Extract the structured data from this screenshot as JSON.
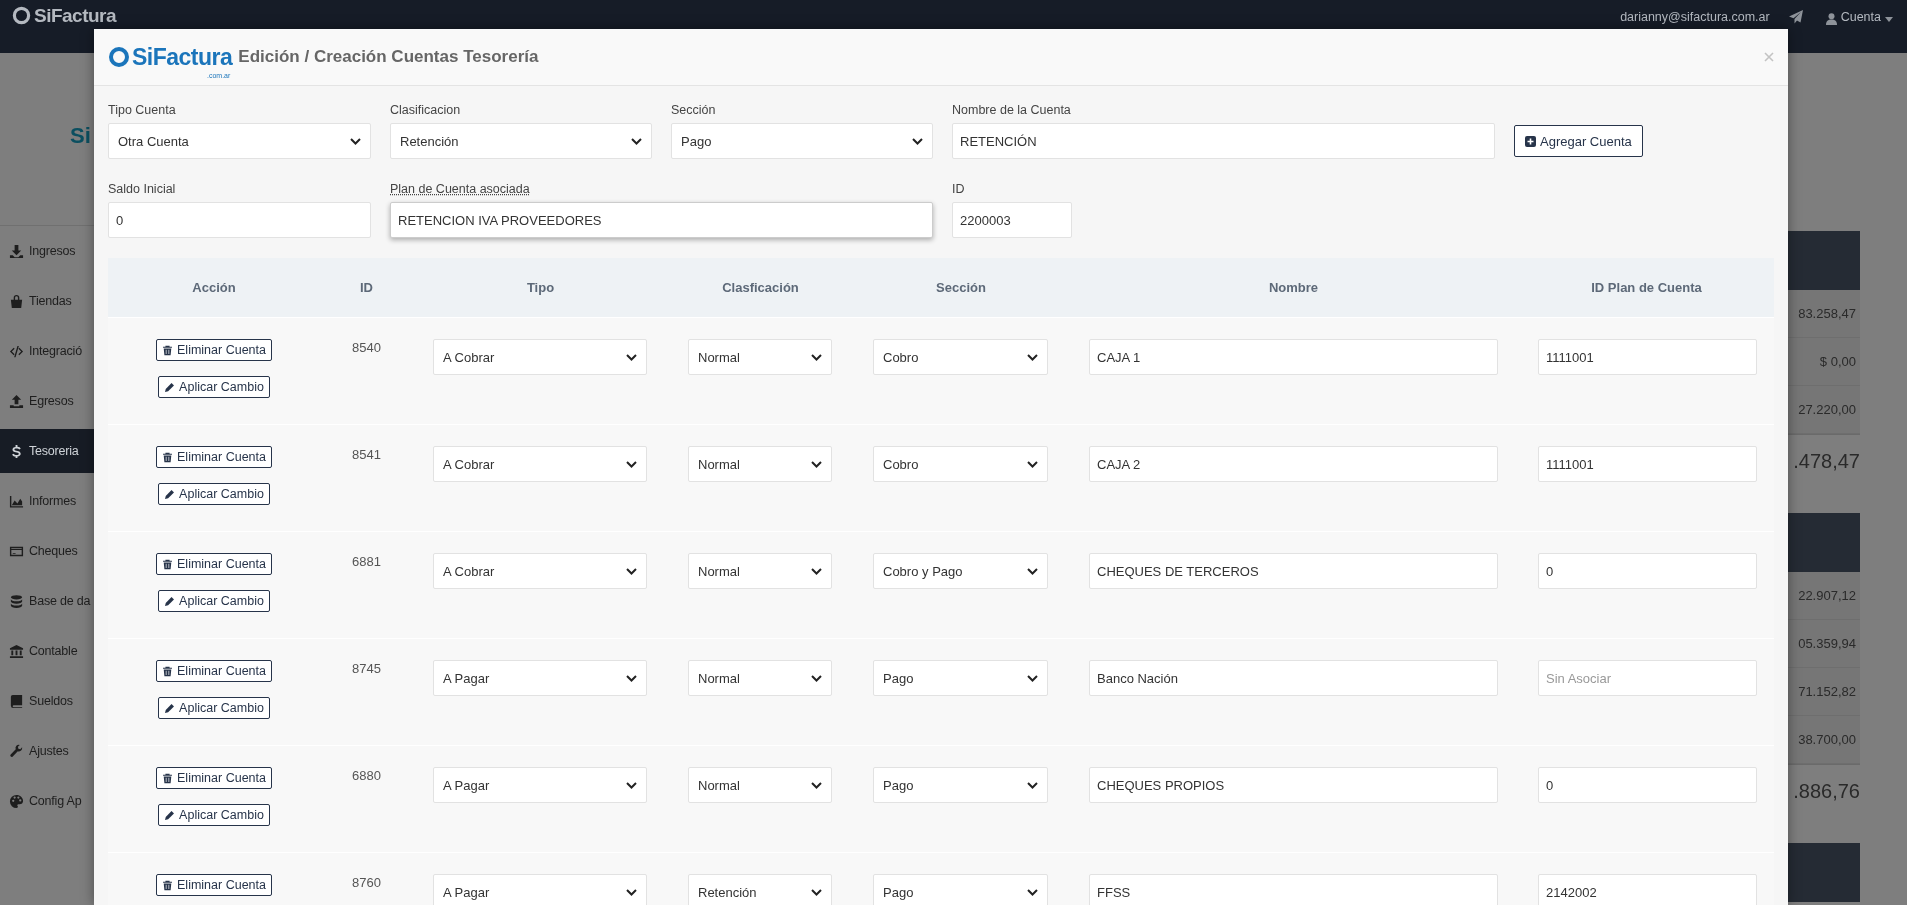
{
  "topbar": {
    "logo": "SiFactura",
    "user_email": "darianny@sifactura.com.ar",
    "account_menu": "Cuenta"
  },
  "sidebar": {
    "brand_partial": "Si",
    "items": [
      {
        "label": "Ingresos",
        "kind": "download",
        "selected": false
      },
      {
        "label": "Tiendas",
        "kind": "bag",
        "selected": false
      },
      {
        "label": "Integració",
        "kind": "code",
        "selected": false
      },
      {
        "label": "Egresos",
        "kind": "upload",
        "selected": false
      },
      {
        "label": "Tesoreria",
        "kind": "dollar",
        "selected": true
      },
      {
        "label": "Informes",
        "kind": "chart",
        "selected": false
      },
      {
        "label": "Cheques",
        "kind": "card",
        "selected": false
      },
      {
        "label": "Base de da",
        "kind": "database",
        "selected": false
      },
      {
        "label": "Contable",
        "kind": "bank",
        "selected": false
      },
      {
        "label": "Sueldos",
        "kind": "book",
        "selected": false
      },
      {
        "label": "Ajustes",
        "kind": "wrench",
        "selected": false
      },
      {
        "label": "Config Ap",
        "kind": "palette",
        "selected": false
      }
    ]
  },
  "background_panel": {
    "groups": [
      {
        "values": [
          "83.258,47",
          "$ 0,00",
          "27.220,00"
        ],
        "total": ".478,47"
      },
      {
        "values": [
          "22.907,12",
          "05.359,94",
          "71.152,82",
          "38.700,00"
        ],
        "total": ".886,76"
      }
    ]
  },
  "modal": {
    "logo": "SiFactura",
    "logo_suffix": ".com.ar",
    "title": "Edición / Creación Cuentas Tesorería",
    "form": {
      "fields": [
        {
          "label": "Tipo Cuenta",
          "kind": "select",
          "value": "Otra Cuenta"
        },
        {
          "label": "Clasificacion",
          "kind": "select",
          "value": "Retención"
        },
        {
          "label": "Sección",
          "kind": "select",
          "value": "Pago"
        },
        {
          "label": "Nombre de la Cuenta",
          "kind": "text",
          "value": "RETENCIÓN"
        },
        {
          "label": "Saldo Inicial",
          "kind": "text",
          "value": "0"
        },
        {
          "label": "Plan de Cuenta asociada",
          "kind": "search",
          "value": "RETENCION IVA PROVEEDORES"
        },
        {
          "label": "ID",
          "kind": "text",
          "value": "2200003"
        }
      ],
      "add_button": "Agregar Cuenta"
    },
    "table": {
      "columns": [
        "Acción",
        "ID",
        "Tipo",
        "Clasficación",
        "Sección",
        "Nombre",
        "ID Plan de Cuenta"
      ],
      "rows": [
        {
          "actions": [
            {
              "kind": "delete",
              "label": "Eliminar Cuenta"
            },
            {
              "kind": "apply",
              "label": "Aplicar Cambio"
            }
          ],
          "id": "8540",
          "tipo": "A Cobrar",
          "clasificacion": "Normal",
          "seccion": "Cobro",
          "nombre": "CAJA 1",
          "id_plan": "1111001"
        },
        {
          "actions": [
            {
              "kind": "delete",
              "label": "Eliminar Cuenta"
            },
            {
              "kind": "apply",
              "label": "Aplicar Cambio"
            }
          ],
          "id": "8541",
          "tipo": "A Cobrar",
          "clasificacion": "Normal",
          "seccion": "Cobro",
          "nombre": "CAJA 2",
          "id_plan": "1111001"
        },
        {
          "actions": [
            {
              "kind": "delete",
              "label": "Eliminar Cuenta"
            },
            {
              "kind": "apply",
              "label": "Aplicar Cambio"
            }
          ],
          "id": "6881",
          "tipo": "A Cobrar",
          "clasificacion": "Normal",
          "seccion": "Cobro y Pago",
          "nombre": "CHEQUES DE TERCEROS",
          "id_plan": "0"
        },
        {
          "actions": [
            {
              "kind": "delete",
              "label": "Eliminar Cuenta"
            },
            {
              "kind": "apply",
              "label": "Aplicar Cambio"
            }
          ],
          "id": "8745",
          "tipo": "A Pagar",
          "clasificacion": "Normal",
          "seccion": "Pago",
          "nombre": "Banco Nación",
          "id_plan_placeholder": "Sin Asociar"
        },
        {
          "actions": [
            {
              "kind": "delete",
              "label": "Eliminar Cuenta"
            },
            {
              "kind": "apply",
              "label": "Aplicar Cambio"
            }
          ],
          "id": "6880",
          "tipo": "A Pagar",
          "clasificacion": "Normal",
          "seccion": "Pago",
          "nombre": "CHEQUES PROPIOS",
          "id_plan": "0"
        },
        {
          "actions": [
            {
              "kind": "delete",
              "label": "Eliminar Cuenta"
            }
          ],
          "id": "8760",
          "tipo": "A Pagar",
          "clasificacion": "Retención",
          "seccion": "Pago",
          "nombre": "FFSS",
          "id_plan": "2142002"
        }
      ]
    }
  }
}
